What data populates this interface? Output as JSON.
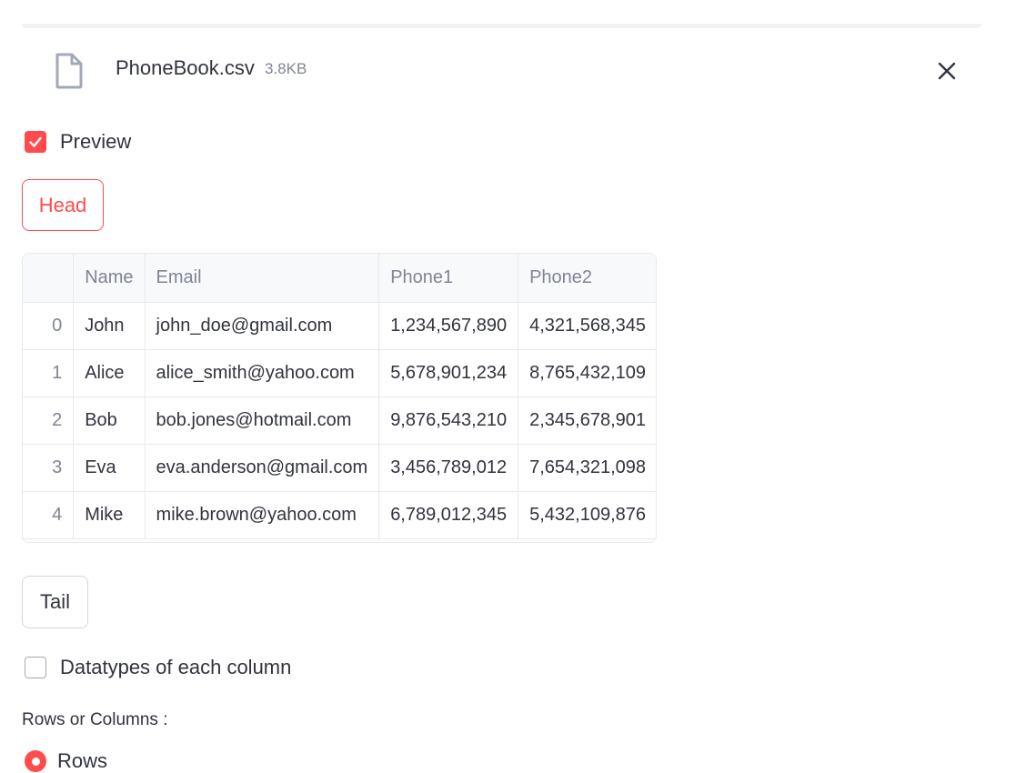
{
  "uploaded_file": {
    "name": "PhoneBook.csv",
    "size": "3.8KB",
    "icon": "file-icon",
    "remove_icon": "close-icon"
  },
  "preview_checkbox": {
    "label": "Preview",
    "checked": true
  },
  "head_button": {
    "label": "Head"
  },
  "table": {
    "columns": [
      "",
      "Name",
      "Email",
      "Phone1",
      "Phone2"
    ],
    "rows": [
      [
        "0",
        "John",
        "john_doe@gmail.com",
        "1,234,567,890",
        "4,321,568,345"
      ],
      [
        "1",
        "Alice",
        "alice_smith@yahoo.com",
        "5,678,901,234",
        "8,765,432,109"
      ],
      [
        "2",
        "Bob",
        "bob.jones@hotmail.com",
        "9,876,543,210",
        "2,345,678,901"
      ],
      [
        "3",
        "Eva",
        "eva.anderson@gmail.com",
        "3,456,789,012",
        "7,654,321,098"
      ],
      [
        "4",
        "Mike",
        "mike.brown@yahoo.com",
        "6,789,012,345",
        "5,432,109,876"
      ]
    ]
  },
  "tail_button": {
    "label": "Tail"
  },
  "datatypes_checkbox": {
    "label": "Datatypes of each column",
    "checked": false
  },
  "rows_or_columns": {
    "label": "Rows or Columns :",
    "selected_option": "Rows"
  },
  "colors": {
    "accent": "#ff4b4b",
    "text": "#31333f",
    "muted": "#808495",
    "border": "#e6e9ef"
  }
}
